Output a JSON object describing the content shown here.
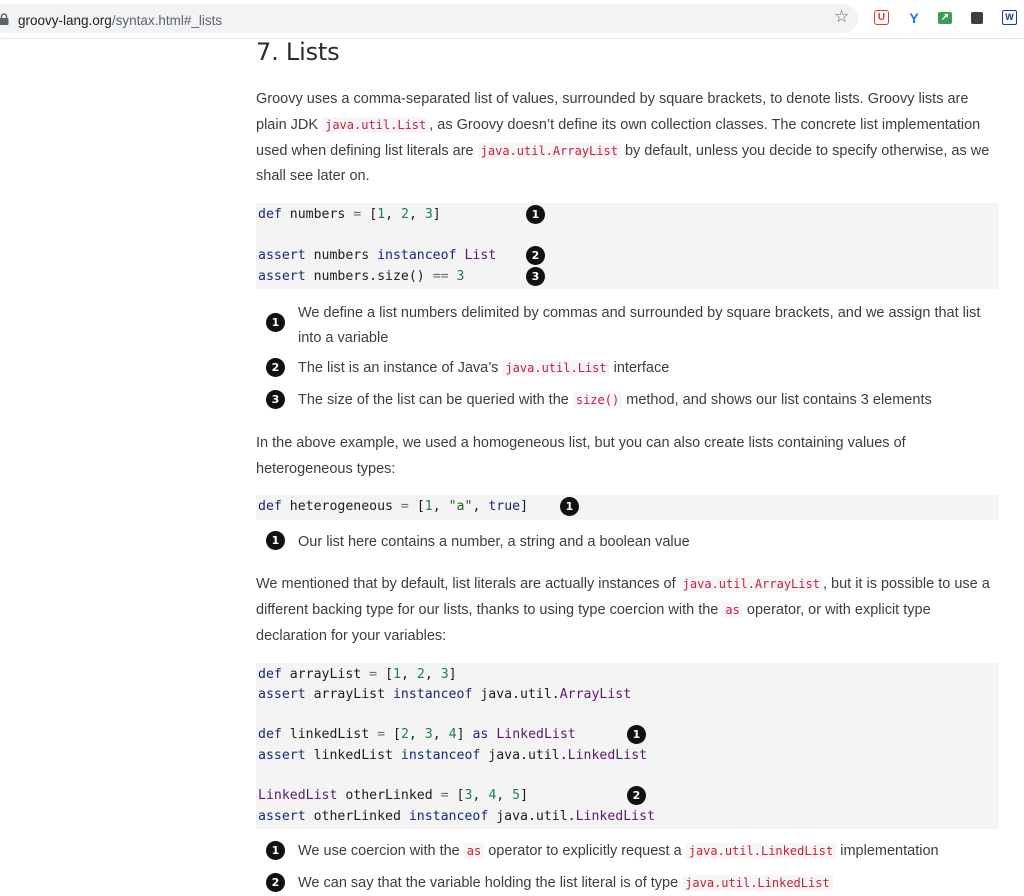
{
  "browser": {
    "url_host": "groovy-lang.org",
    "url_path": "/syntax.html#_lists"
  },
  "page": {
    "heading": "7. Lists",
    "p1": {
      "t1": "Groovy uses a comma-separated list of values, surrounded by square brackets, to denote lists. Groovy lists are plain JDK ",
      "c1": "java.util.List",
      "t2": ", as Groovy doesn’t define its own collection classes. The concrete list implementation used when defining list literals are ",
      "c2": "java.util.ArrayList",
      "t3": " by default, unless you decide to specify otherwise, as we shall see later on."
    },
    "code1": {
      "l1": "def numbers = [1, 2, 3]",
      "l2": "assert numbers instanceof List",
      "l3": "assert numbers.size() == 3"
    },
    "callouts1": {
      "n1": "1",
      "n2": "2",
      "n3": "3",
      "i1": "We define a list numbers delimited by commas and surrounded by square brackets, and we assign that list into a variable",
      "i2a": "The list is an instance of Java’s ",
      "i2c": "java.util.List",
      "i2b": " interface",
      "i3a": "The size of the list can be queried with the ",
      "i3c": "size()",
      "i3b": " method, and shows our list contains 3 elements"
    },
    "p2": "In the above example, we used a homogeneous list, but you can also create lists containing values of heterogeneous types:",
    "code2": {
      "l1": "def heterogeneous = [1, \"a\", true]"
    },
    "callouts2": {
      "n1": "1",
      "i1": "Our list here contains a number, a string and a boolean value"
    },
    "p3": {
      "t1": "We mentioned that by default, list literals are actually instances of ",
      "c1": "java.util.ArrayList",
      "t2": ", but it is possible to use a different backing type for our lists, thanks to using type coercion with the ",
      "c2": "as",
      "t3": " operator, or with explicit type declaration for your variables:"
    },
    "code3": {
      "l1": "def arrayList = [1, 2, 3]",
      "l2": "assert arrayList instanceof java.util.ArrayList",
      "l3": "def linkedList = [2, 3, 4] as LinkedList",
      "l4": "assert linkedList instanceof java.util.LinkedList",
      "l5": "LinkedList otherLinked = [3, 4, 5]",
      "l6": "assert otherLinked instanceof java.util.LinkedList"
    },
    "callouts3": {
      "n1": "1",
      "n2": "2",
      "i1a": "We use coercion with the ",
      "i1c": "as",
      "i1b": " operator to explicitly request a ",
      "i1d": "java.util.LinkedList",
      "i1e": " implementation",
      "i2a": "We can say that the variable holding the list literal is of type ",
      "i2c": "java.util.LinkedList"
    }
  }
}
